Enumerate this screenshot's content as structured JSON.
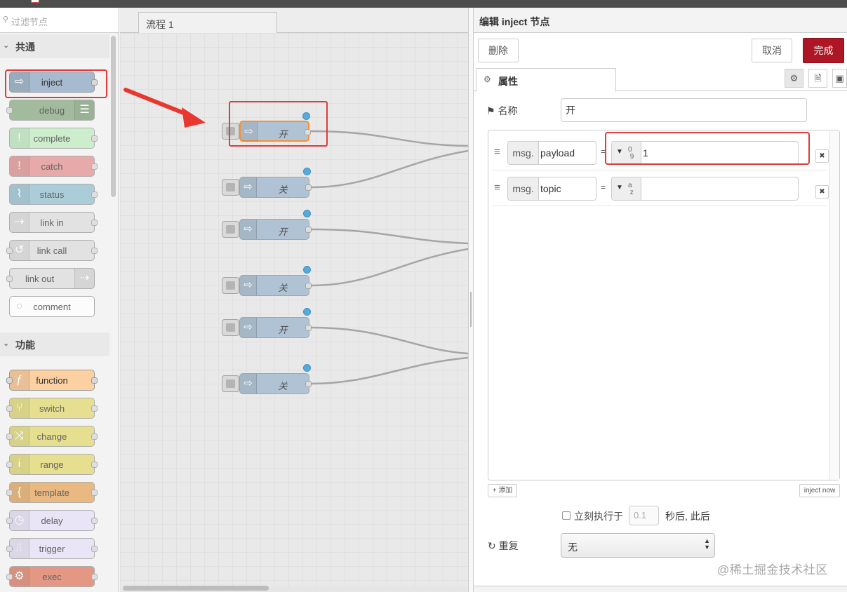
{
  "palette": {
    "search_placeholder": "过滤节点",
    "categories": [
      {
        "label": "共通"
      },
      {
        "label": "功能"
      }
    ],
    "common_nodes": [
      {
        "label": "inject",
        "color": "#a6bbcf",
        "icon": "inject-arrow-icon"
      },
      {
        "label": "debug",
        "color": "#87a980",
        "icon": "debug-list-icon"
      },
      {
        "label": "complete",
        "color": "#c0edc0",
        "icon": "exclamation-icon"
      },
      {
        "label": "catch",
        "color": "#e49191",
        "icon": "exclamation-icon"
      },
      {
        "label": "status",
        "color": "#94c1d0",
        "icon": "status-pulse-icon"
      },
      {
        "label": "link in",
        "color": "#dddddd",
        "icon": "link-in-icon"
      },
      {
        "label": "link call",
        "color": "#dddddd",
        "icon": "link-call-icon"
      },
      {
        "label": "link out",
        "color": "#dddddd",
        "icon": "link-out-icon"
      },
      {
        "label": "comment",
        "color": "#ffffff",
        "icon": "comment-icon"
      }
    ],
    "function_nodes": [
      {
        "label": "function",
        "color": "#fdd0a2",
        "icon": "function-icon"
      },
      {
        "label": "switch",
        "color": "#e2d96e",
        "icon": "switch-icon"
      },
      {
        "label": "change",
        "color": "#e2d96e",
        "icon": "change-icon"
      },
      {
        "label": "range",
        "color": "#e2d96e",
        "icon": "range-icon"
      },
      {
        "label": "template",
        "color": "#e6a65c",
        "icon": "template-brace-icon"
      },
      {
        "label": "delay",
        "color": "#e6e0f8",
        "icon": "delay-clock-icon"
      },
      {
        "label": "trigger",
        "color": "#e6e0f8",
        "icon": "trigger-icon"
      },
      {
        "label": "exec",
        "color": "#e07a5f",
        "icon": "exec-gear-icon"
      }
    ]
  },
  "workspace": {
    "tab_label": "流程 1",
    "flow_nodes": [
      {
        "label": "开",
        "selected": true
      },
      {
        "label": "关",
        "selected": false
      },
      {
        "label": "开",
        "selected": false
      },
      {
        "label": "关",
        "selected": false
      },
      {
        "label": "开",
        "selected": false
      },
      {
        "label": "关",
        "selected": false
      }
    ]
  },
  "editor": {
    "title": "编辑 inject 节点",
    "delete_label": "删除",
    "cancel_label": "取消",
    "done_label": "完成",
    "tab_properties": "属性",
    "name_label": "名称",
    "name_value": "开",
    "props": [
      {
        "prefix": "msg.",
        "name": "payload",
        "type_glyph_top": "0",
        "type_glyph_bottom": "9",
        "value": "1"
      },
      {
        "prefix": "msg.",
        "name": "topic",
        "type_glyph_top": "a",
        "type_glyph_bottom": "z",
        "value": ""
      }
    ],
    "add_label": "添加",
    "inject_now_label": "inject now",
    "once_label": "立刻执行于",
    "once_delay_placeholder": "0.1",
    "once_suffix": "秒后, 此后",
    "repeat_label": "重复",
    "repeat_value": "无"
  },
  "watermark": "@稀土掘金技术社区",
  "colors": {
    "accent": "#ad1625",
    "annotation_red": "#e03a3a",
    "inject_node": "#a6bbcf",
    "status_dot": "#3f9fd8"
  }
}
